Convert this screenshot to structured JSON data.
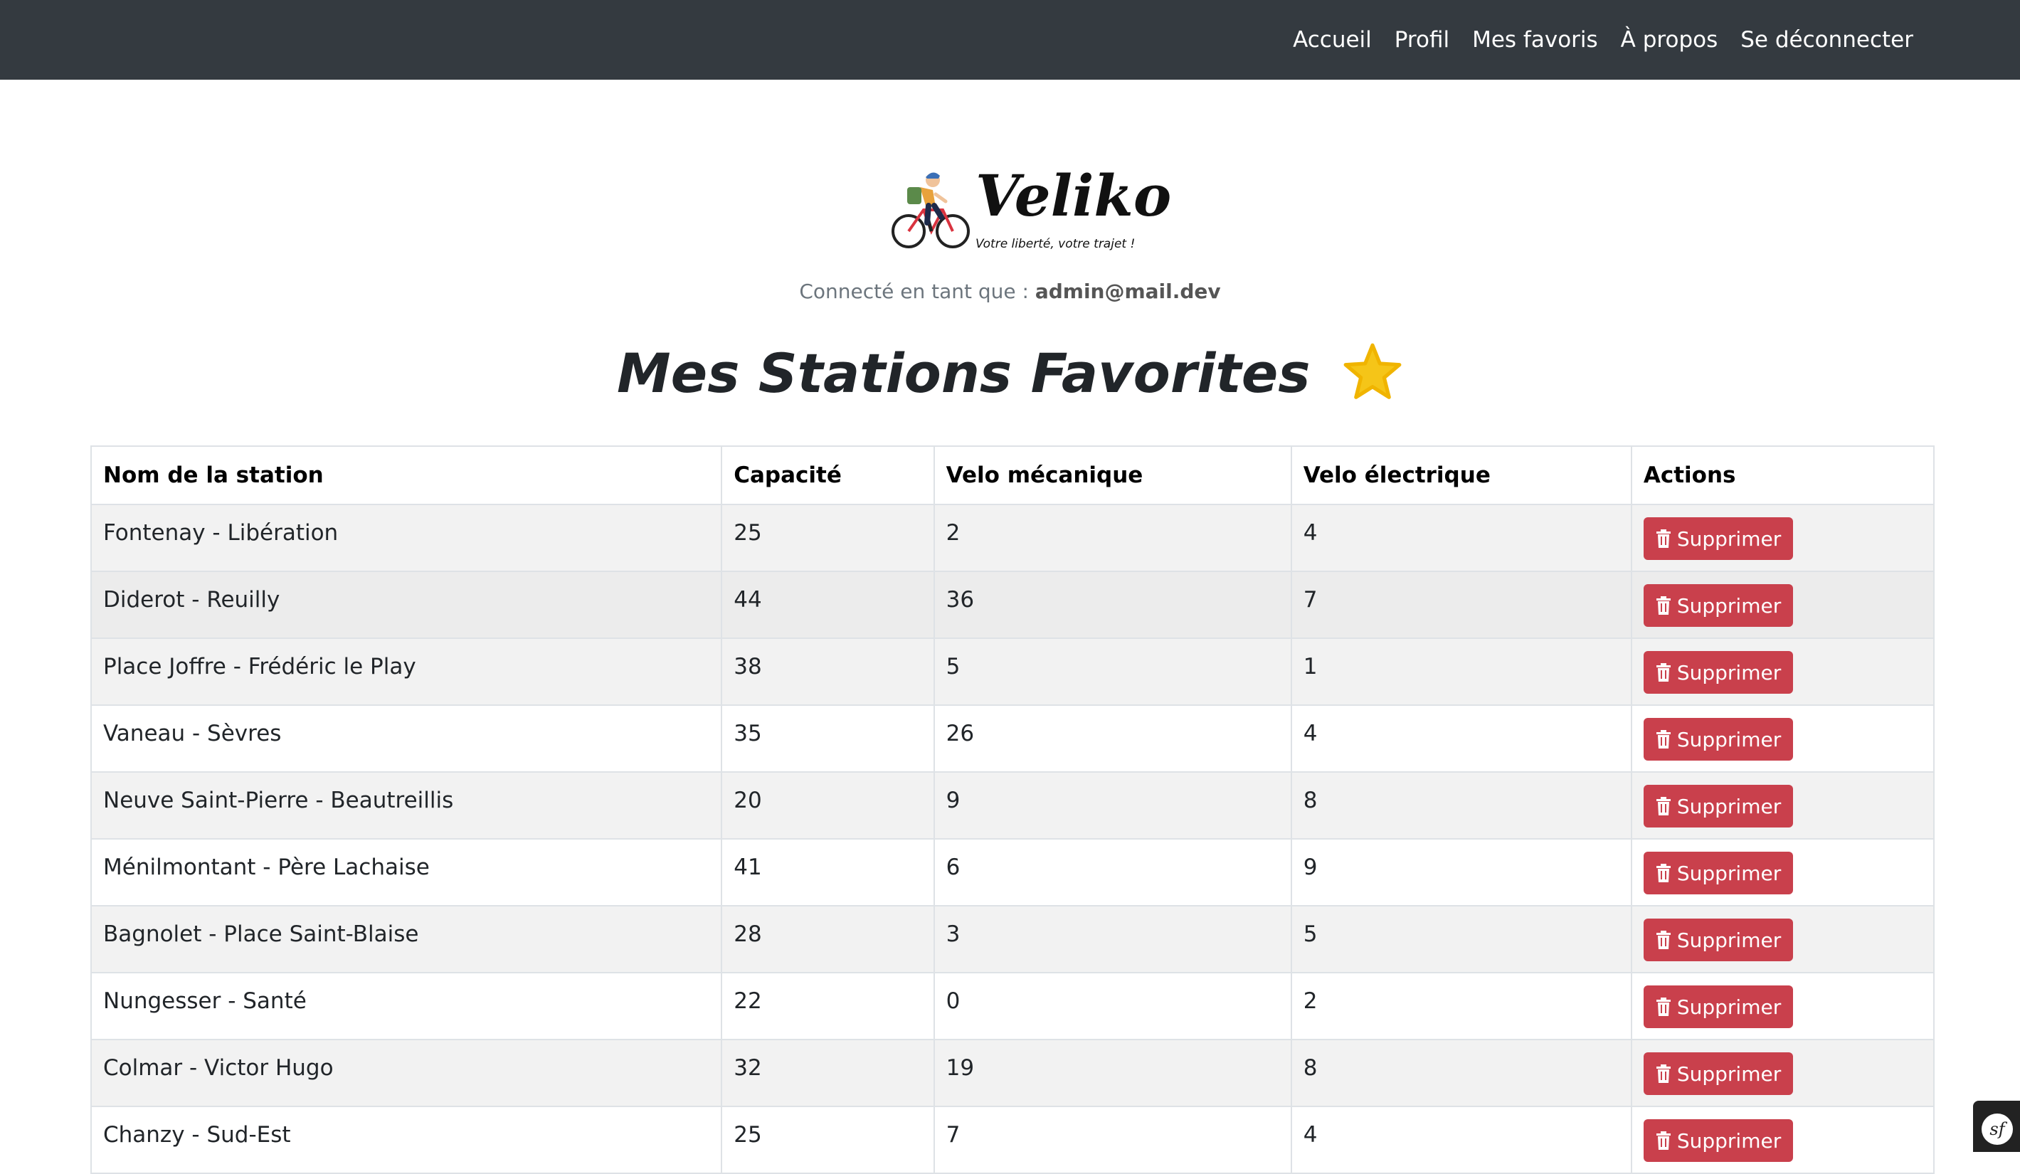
{
  "nav": {
    "items": [
      {
        "label": "Accueil"
      },
      {
        "label": "Profil"
      },
      {
        "label": "Mes favoris"
      },
      {
        "label": "À propos"
      },
      {
        "label": "Se déconnecter"
      }
    ]
  },
  "logo": {
    "brand": "Veliko",
    "tagline": "Votre liberté, votre trajet !"
  },
  "user": {
    "prefix": "Connecté en tant que : ",
    "email": "admin@mail.dev"
  },
  "page": {
    "title": "Mes Stations Favorites",
    "title_icon": "star-icon"
  },
  "table": {
    "headers": [
      "Nom de la station",
      "Capacité",
      "Velo mécanique",
      "Velo électrique",
      "Actions"
    ],
    "delete_label": "Supprimer",
    "rows": [
      {
        "name": "Fontenay - Libération",
        "capacity": "25",
        "mechanical": "2",
        "electric": "4"
      },
      {
        "name": "Diderot - Reuilly",
        "capacity": "44",
        "mechanical": "36",
        "electric": "7"
      },
      {
        "name": "Place Joffre - Frédéric le Play",
        "capacity": "38",
        "mechanical": "5",
        "electric": "1"
      },
      {
        "name": "Vaneau - Sèvres",
        "capacity": "35",
        "mechanical": "26",
        "electric": "4"
      },
      {
        "name": "Neuve Saint-Pierre - Beautreillis",
        "capacity": "20",
        "mechanical": "9",
        "electric": "8"
      },
      {
        "name": "Ménilmontant - Père Lachaise",
        "capacity": "41",
        "mechanical": "6",
        "electric": "9"
      },
      {
        "name": "Bagnolet - Place Saint-Blaise",
        "capacity": "28",
        "mechanical": "3",
        "electric": "5"
      },
      {
        "name": "Nungesser - Santé",
        "capacity": "22",
        "mechanical": "0",
        "electric": "2"
      },
      {
        "name": "Colmar - Victor Hugo",
        "capacity": "32",
        "mechanical": "19",
        "electric": "8"
      },
      {
        "name": "Chanzy - Sud-Est",
        "capacity": "25",
        "mechanical": "7",
        "electric": "4"
      }
    ]
  },
  "debug_toolbar": {
    "label": "sf"
  },
  "colors": {
    "navbar": "#343a40",
    "danger": "#c9404c",
    "star": "#f5c518"
  }
}
